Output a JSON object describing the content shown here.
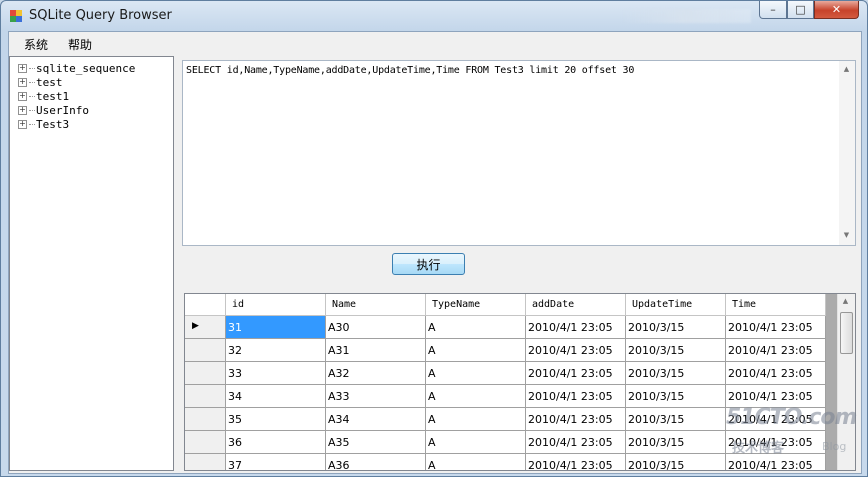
{
  "window": {
    "title": "SQLite Query Browser",
    "controls": {
      "minimize": "–",
      "maximize": "□",
      "close": "✕"
    }
  },
  "menu": [
    {
      "label": "系统"
    },
    {
      "label": "帮助"
    }
  ],
  "tree": {
    "expand_glyph": "+",
    "items": [
      {
        "label": "sqlite_sequence"
      },
      {
        "label": "test"
      },
      {
        "label": "test1"
      },
      {
        "label": "UserInfo"
      },
      {
        "label": "Test3"
      }
    ]
  },
  "query": {
    "text": "SELECT id,Name,TypeName,addDate,UpdateTime,Time FROM Test3 limit 20 offset 30"
  },
  "execute_button": {
    "label": "执行"
  },
  "grid": {
    "columns": [
      "id",
      "Name",
      "TypeName",
      "addDate",
      "UpdateTime",
      "Time"
    ],
    "rows": [
      [
        "31",
        "A30",
        "A",
        "2010/4/1 23:05",
        "2010/3/15",
        "2010/4/1 23:05"
      ],
      [
        "32",
        "A31",
        "A",
        "2010/4/1 23:05",
        "2010/3/15",
        "2010/4/1 23:05"
      ],
      [
        "33",
        "A32",
        "A",
        "2010/4/1 23:05",
        "2010/3/15",
        "2010/4/1 23:05"
      ],
      [
        "34",
        "A33",
        "A",
        "2010/4/1 23:05",
        "2010/3/15",
        "2010/4/1 23:05"
      ],
      [
        "35",
        "A34",
        "A",
        "2010/4/1 23:05",
        "2010/3/15",
        "2010/4/1 23:05"
      ],
      [
        "36",
        "A35",
        "A",
        "2010/4/1 23:05",
        "2010/3/15",
        "2010/4/1 23:05"
      ],
      [
        "37",
        "A36",
        "A",
        "2010/4/1 23:05",
        "2010/3/15",
        "2010/4/1 23:05"
      ]
    ],
    "current_row_glyph": "▶",
    "selected_cell": {
      "row": 0,
      "col": 0
    }
  },
  "watermark": {
    "main": "51CTO.com",
    "sub": "技术博客",
    "tag": "Blog"
  },
  "colors": {
    "selection": "#3399ff",
    "titlebar": "#c3d6ea",
    "close_button": "#c7432b"
  }
}
